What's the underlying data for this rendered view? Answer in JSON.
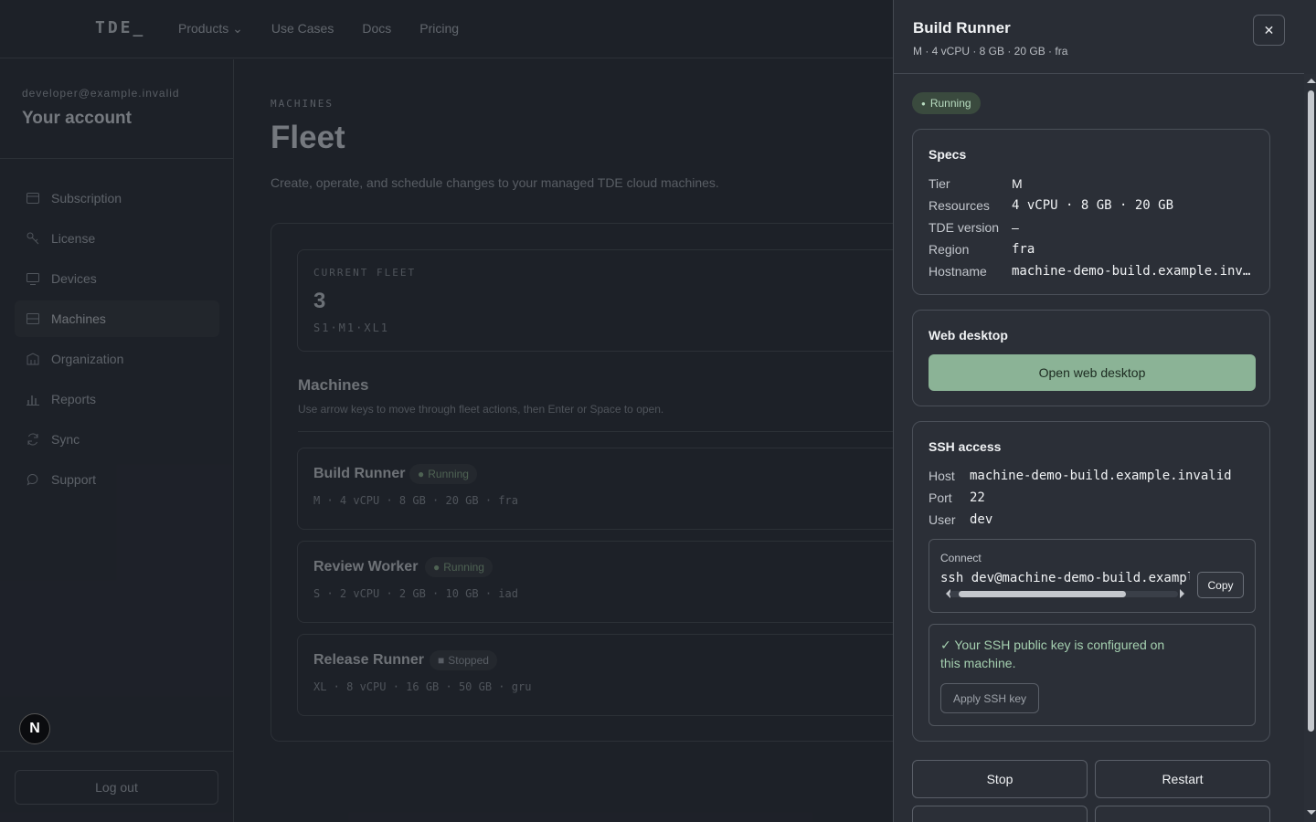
{
  "topbar": {
    "logo": "TDE_",
    "nav": [
      "Products ⌄",
      "Use Cases",
      "Docs",
      "Pricing"
    ]
  },
  "sidebar": {
    "email": "developer@example.invalid",
    "title": "Your account",
    "items": [
      {
        "label": "Subscription",
        "icon": "card-icon"
      },
      {
        "label": "License",
        "icon": "key-icon"
      },
      {
        "label": "Devices",
        "icon": "monitor-icon"
      },
      {
        "label": "Machines",
        "icon": "server-icon"
      },
      {
        "label": "Organization",
        "icon": "building-icon"
      },
      {
        "label": "Reports",
        "icon": "bar-chart-icon"
      },
      {
        "label": "Sync",
        "icon": "sync-icon"
      },
      {
        "label": "Support",
        "icon": "chat-icon"
      }
    ],
    "active_item": "Machines",
    "logout": "Log out",
    "badge": "N"
  },
  "main": {
    "eyebrow": "MACHINES",
    "title": "Fleet",
    "description": "Create, operate, and schedule changes to your managed TDE cloud machines.",
    "current_fleet": {
      "label": "CURRENT FLEET",
      "count": "3",
      "mix": "S1·M1·XL1"
    },
    "machines_title": "Machines",
    "machines_hint": "Use arrow keys to move through fleet actions, then Enter or Space to open.",
    "machines": [
      {
        "name": "Build Runner",
        "status": "Running",
        "specs": "M · 4 vCPU · 8 GB · 20 GB · fra"
      },
      {
        "name": "Review Worker",
        "status": "Running",
        "specs": "S · 2 vCPU · 2 GB · 10 GB · iad"
      },
      {
        "name": "Release Runner",
        "status": "Stopped",
        "specs": "XL · 8 vCPU · 16 GB · 50 GB · gru"
      }
    ]
  },
  "drawer": {
    "title": "Build Runner",
    "subtitle": "M · 4 vCPU · 8 GB · 20 GB · fra",
    "close": "✕",
    "status": "Running",
    "specs": {
      "title": "Specs",
      "rows": [
        {
          "label": "Tier",
          "value": "M"
        },
        {
          "label": "Resources",
          "value": "4 vCPU · 8 GB · 20 GB"
        },
        {
          "label": "TDE version",
          "value": "–"
        },
        {
          "label": "Region",
          "value": "fra"
        },
        {
          "label": "Hostname",
          "value": "machine-demo-build.example.invalid"
        }
      ]
    },
    "web_desktop": {
      "title": "Web desktop",
      "button": "Open web desktop"
    },
    "ssh": {
      "title": "SSH access",
      "rows": [
        {
          "label": "Host",
          "value": "machine-demo-build.example.invalid"
        },
        {
          "label": "Port",
          "value": "22"
        },
        {
          "label": "User",
          "value": "dev"
        }
      ],
      "connect_label": "Connect",
      "connect_command": "ssh dev@machine-demo-build.example.invalid",
      "copy": "Copy",
      "key_message": "✓ Your SSH public key is configured on this machine.",
      "apply_key": "Apply SSH key"
    },
    "actions": [
      "Stop",
      "Restart"
    ]
  },
  "colors": {
    "background": "#232730",
    "drawer": "#292d35",
    "accent_green": "#8bb396",
    "running_text": "#b8dcc0"
  }
}
